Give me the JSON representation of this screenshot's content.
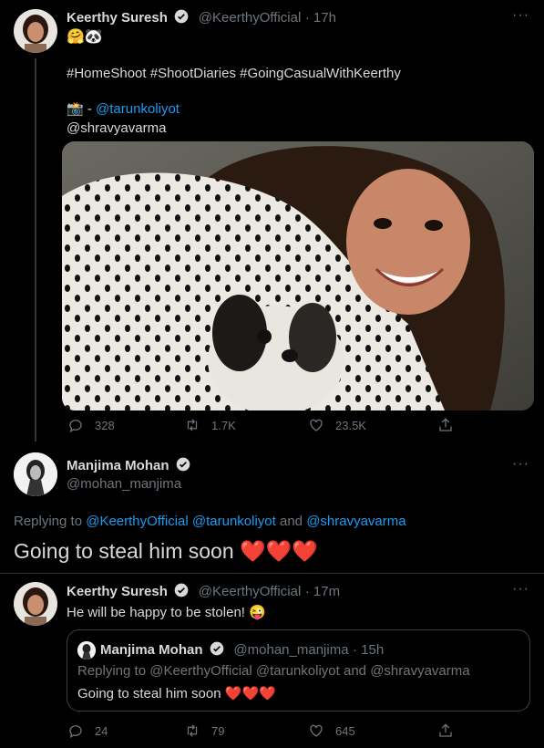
{
  "tweet1": {
    "name": "Keerthy Suresh",
    "handle": "@KeerthyOfficial",
    "time": "· 17h",
    "emoji": "🤗🐼",
    "hashtags": "#HomeShoot #ShootDiaries #GoingCasualWithKeerthy",
    "credit_emoji": "📸",
    "credit_dash": " - ",
    "credit_user1": "@tarunkoliyot",
    "credit_user2": "@shravyavarma",
    "actions": {
      "reply": "328",
      "retweet": "1.7K",
      "like": "23.5K"
    }
  },
  "tweet2": {
    "name": "Manjima Mohan",
    "handle": "@mohan_manjima",
    "replying_prefix": "Replying to ",
    "replying_users": "@KeerthyOfficial @tarunkoliyot",
    "replying_and": " and ",
    "replying_last": "@shravyavarma",
    "text": "Going to steal him soon ",
    "hearts": "❤️❤️❤️"
  },
  "tweet3": {
    "name": "Keerthy Suresh",
    "handle": "@KeerthyOfficial",
    "time": "· 17m",
    "text": "He will be happy to be stolen! ",
    "emoji": "😜",
    "quote": {
      "name": "Manjima Mohan",
      "handle": "@mohan_manjima",
      "time": "· 15h",
      "replying_prefix": "Replying to ",
      "replying_users": "@KeerthyOfficial @tarunkoliyot",
      "replying_and": " and ",
      "replying_last": "@shravyavarma",
      "text": "Going to steal him soon ",
      "hearts": "❤️❤️❤️"
    },
    "actions": {
      "reply": "24",
      "retweet": "79",
      "like": "645"
    }
  },
  "more_label": "···",
  "colors": {
    "background": "#000000",
    "link": "#1d9bf0",
    "muted": "#6e767d",
    "text": "#d9d9d9"
  }
}
